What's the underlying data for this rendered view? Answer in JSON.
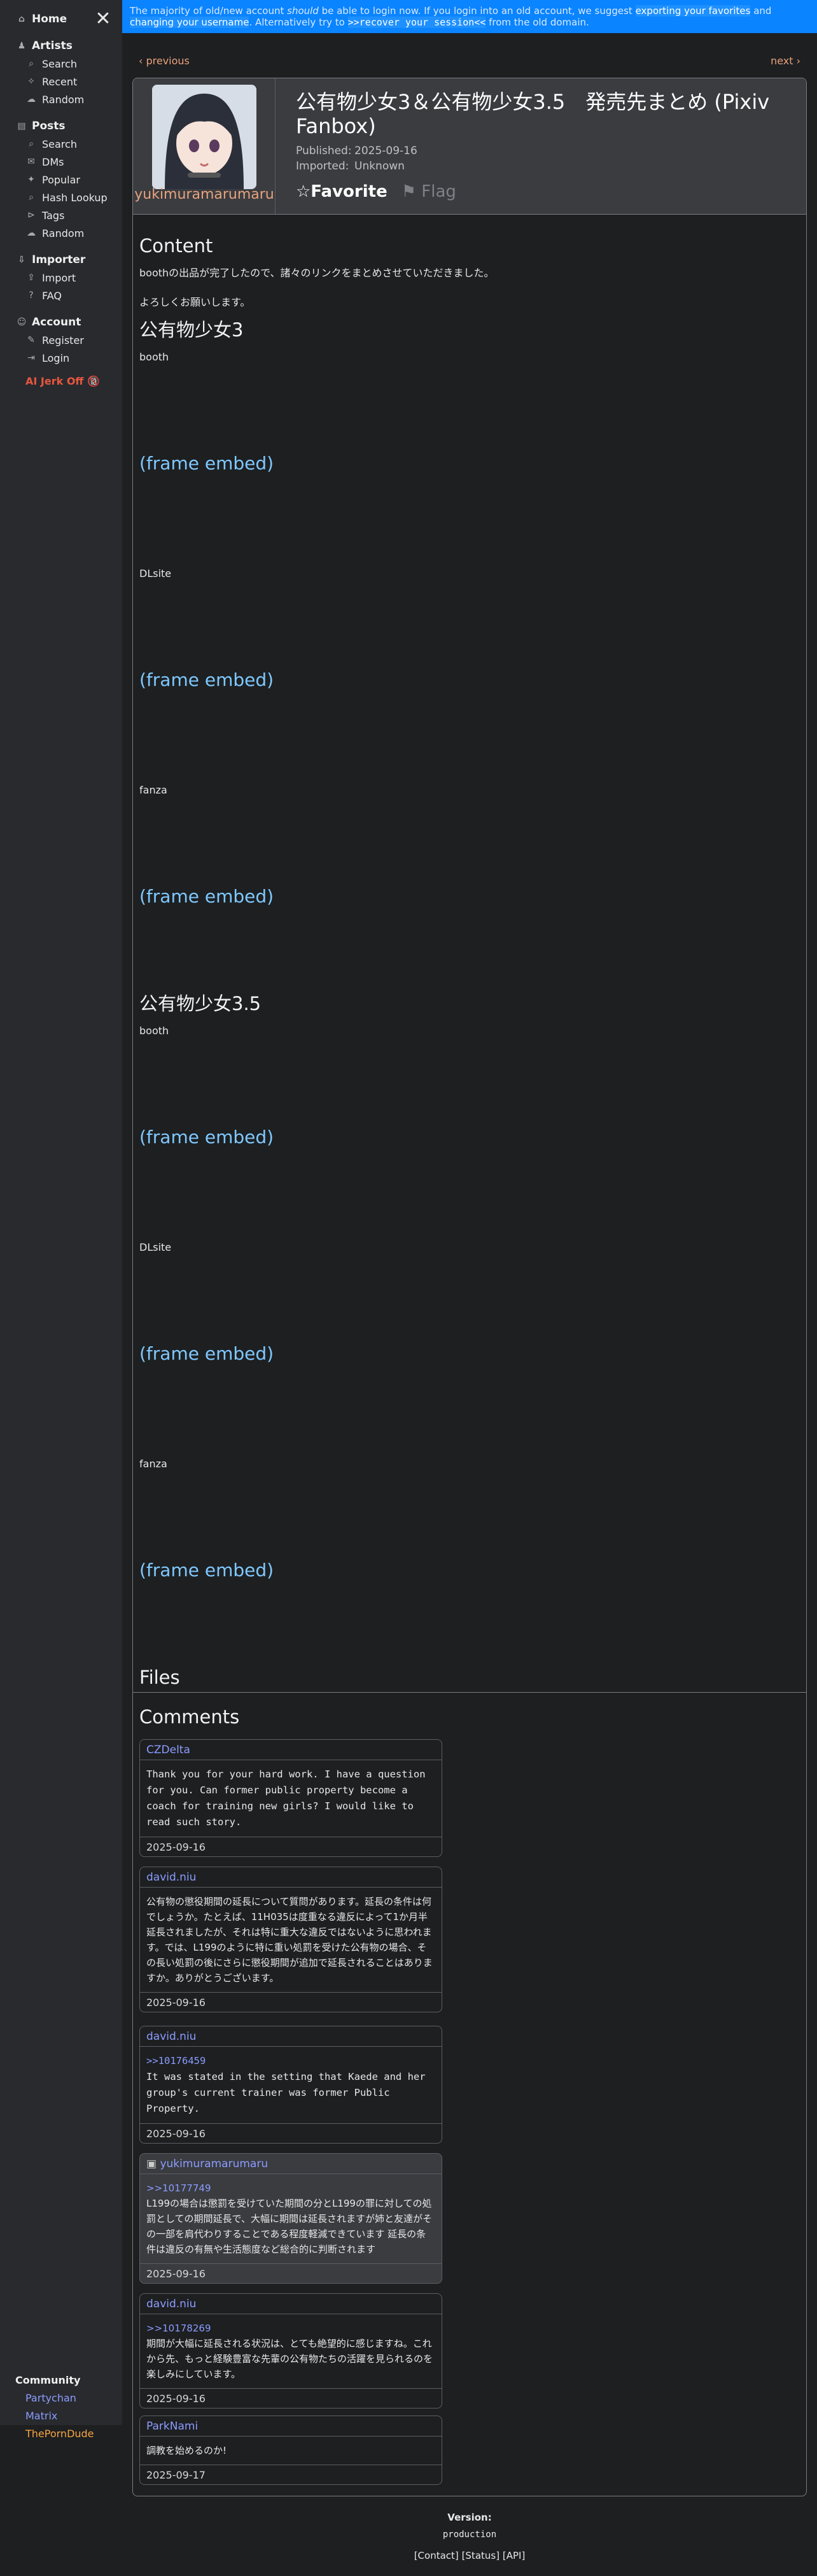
{
  "banner": {
    "part1": "The majority of old/new account ",
    "should": "should",
    "part2": " be able to login now. If you login into an old account, we suggest ",
    "exporting": "exporting your favorites",
    "and": " and ",
    "changing": "changing your username",
    "part3": ". Alternatively try to ",
    "recover": ">>recover your session<<",
    "part4": " from the old domain."
  },
  "sidebar": {
    "home": "Home",
    "artists": "Artists",
    "artists_items": [
      "Search",
      "Recent",
      "Random"
    ],
    "posts": "Posts",
    "posts_items": [
      "Search",
      "DMs",
      "Popular",
      "Hash Lookup",
      "Tags",
      "Random"
    ],
    "importer": "Importer",
    "importer_items": [
      "Import",
      "FAQ"
    ],
    "account": "Account",
    "account_items": [
      "Register",
      "Login"
    ],
    "jerk": "AI Jerk Off 🔞",
    "community": "Community",
    "community_links": [
      {
        "label": "Partychan",
        "color": "#8c9cff"
      },
      {
        "label": "Matrix",
        "color": "#8c9cff"
      },
      {
        "label": "ThePornDude",
        "color": "#f7a440"
      }
    ]
  },
  "nav": {
    "previous": "‹ previous",
    "next": "next ›"
  },
  "post": {
    "artist": "yukimuramarumaru",
    "title": "公有物少女3＆公有物少女3.5　発売先まとめ (Pixiv Fanbox)",
    "published_label": "Published:",
    "published": "2025-09-16",
    "imported_label": "Imported:",
    "imported": "Unknown",
    "favorite": "☆Favorite",
    "flag": "⚑ Flag"
  },
  "content": {
    "heading": "Content",
    "intro1": "boothの出品が完了したので、諸々のリンクをまとめさせていただきました。",
    "intro2": "よろしくお願いします。",
    "section1": "公有物少女3",
    "section2": "公有物少女3.5",
    "store_booth": "booth",
    "store_dlsite": "DLsite",
    "store_fanza": "fanza",
    "embed": "(frame embed)"
  },
  "files_heading": "Files",
  "comments_heading": "Comments",
  "comments": [
    {
      "author": "CZDelta",
      "reply": "",
      "text": "Thank you for your hard work. I have a question for you. Can former public property become a coach for training new girls? I would like to read such story.",
      "date": "2025-09-16"
    },
    {
      "author": "david.niu",
      "reply": "",
      "text": "公有物の懲役期間の延長について質問があります。延長の条件は何でしょうか。たとえば、11H035は度重なる違反によって1か月半延長されましたが、それは特に重大な違反ではないように思われます。では、L199のように特に重い処罰を受けた公有物の場合、その長い処罰の後にさらに懲役期間が追加で延長されることはありますか。ありがとうございます。",
      "date": "2025-09-16"
    },
    {
      "author": "david.niu",
      "reply": ">>10176459",
      "text": "It was stated in the setting that Kaede and her group's current trainer was former Public Property.",
      "date": "2025-09-16"
    },
    {
      "author": "yukimuramarumaru",
      "reply": ">>10177749",
      "text": "L199の場合は懲罰を受けていた期間の分とL199の罪に対しての処罰としての期間延長で、大幅に期間は延長されますが姉と友達がその一部を肩代わりすることである程度軽減できています 延長の条件は違反の有無や生活態度など総合的に判断されます",
      "date": "2025-09-16"
    },
    {
      "author": "david.niu",
      "reply": ">>10178269",
      "text": "期間が大幅に延長される状況は、とても絶望的に感じますね。これから先、もっと経験豊富な先輩の公有物たちの活躍を見られるのを楽しみにしています。",
      "date": "2025-09-16"
    },
    {
      "author": "ParkNami",
      "reply": "",
      "text": "調教を始めるのか!",
      "date": "2025-09-17"
    }
  ],
  "footer": {
    "version_label": "Version:",
    "mode": "production",
    "contact": "[Contact]",
    "status": "[Status]",
    "api": "[API]"
  }
}
